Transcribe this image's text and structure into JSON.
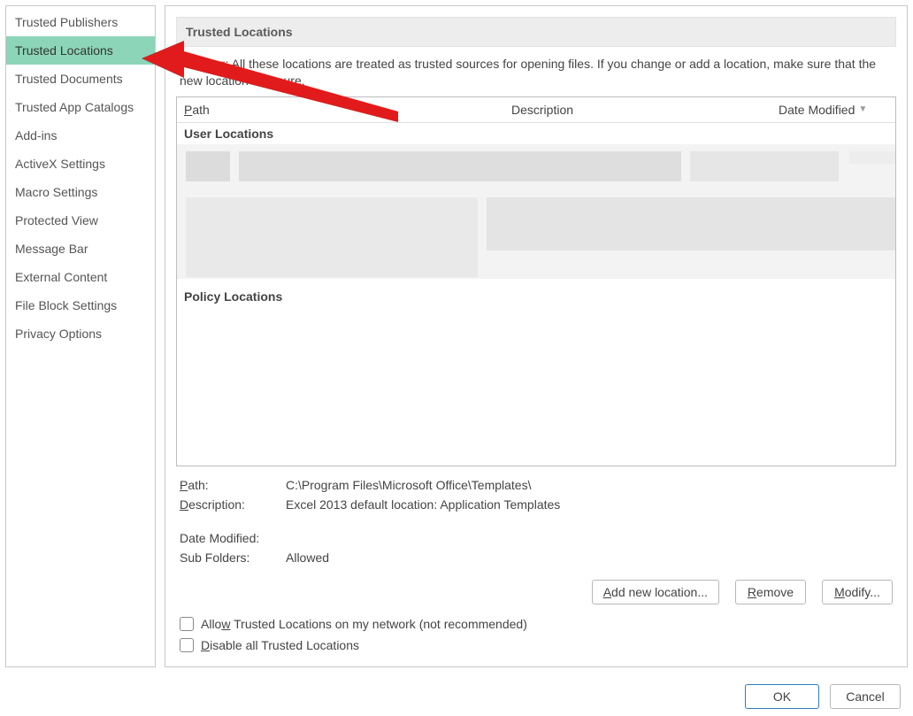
{
  "sidebar": {
    "items": [
      {
        "label": "Trusted Publishers"
      },
      {
        "label": "Trusted Locations"
      },
      {
        "label": "Trusted Documents"
      },
      {
        "label": "Trusted App Catalogs"
      },
      {
        "label": "Add-ins"
      },
      {
        "label": "ActiveX Settings"
      },
      {
        "label": "Macro Settings"
      },
      {
        "label": "Protected View"
      },
      {
        "label": "Message Bar"
      },
      {
        "label": "External Content"
      },
      {
        "label": "File Block Settings"
      },
      {
        "label": "Privacy Options"
      }
    ],
    "selected_index": 1
  },
  "panel": {
    "heading": "Trusted Locations",
    "warning": "Warning: All these locations are treated as trusted sources for opening files.  If you change or add a location, make sure that the new location is secure."
  },
  "table": {
    "columns": {
      "path": "Path",
      "description": "Description",
      "date_modified": "Date Modified"
    },
    "section_user": "User Locations",
    "section_policy": "Policy Locations"
  },
  "details": {
    "path_label": "Path:",
    "path_value": "C:\\Program Files\\Microsoft Office\\Templates\\",
    "description_label": "Description:",
    "description_value": "Excel 2013 default location: Application Templates",
    "date_modified_label": "Date Modified:",
    "date_modified_value": "",
    "sub_folders_label": "Sub Folders:",
    "sub_folders_value": "Allowed"
  },
  "buttons": {
    "add": "Add new location...",
    "remove": "Remove",
    "modify": "Modify..."
  },
  "checkboxes": {
    "allow_network": "Allow Trusted Locations on my network (not recommended)",
    "disable_all": "Disable all Trusted Locations"
  },
  "footer": {
    "ok": "OK",
    "cancel": "Cancel"
  }
}
